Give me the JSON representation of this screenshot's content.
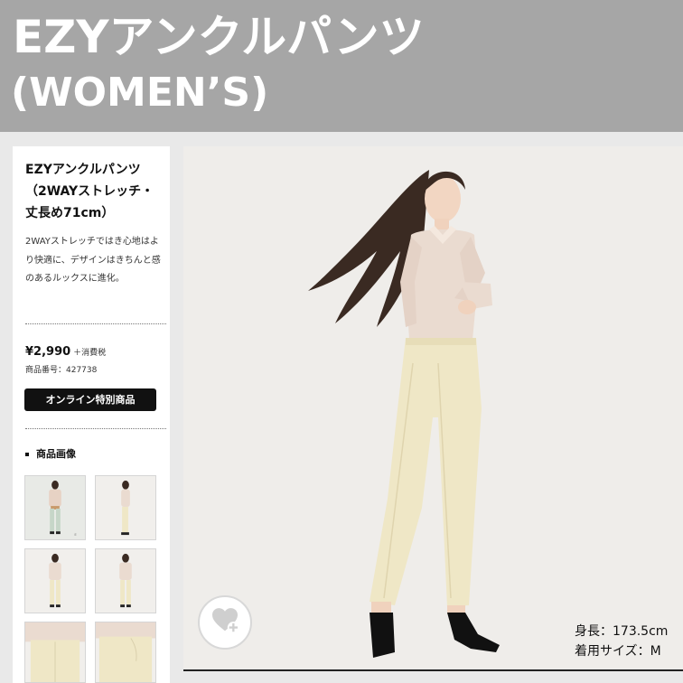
{
  "banner": {
    "title_line1": "EZYアンクルパンツ",
    "title_line2": "(WOMEN’S)"
  },
  "product": {
    "title": "EZYアンクルパンツ（2WAYストレッチ・丈長め71cm）",
    "description": "2WAYストレッチではき心地はより快適に、デザインはきちんと感のあるルックスに進化。",
    "price": "¥2,990",
    "tax_note": "＋消費税",
    "product_number": "商品番号：427738",
    "online_badge": "オンライン特別商品"
  },
  "gallery": {
    "heading": "商品画像",
    "thumbnails": [
      {
        "name": "front-full",
        "icon": "model-front"
      },
      {
        "name": "side-full",
        "icon": "model-side"
      },
      {
        "name": "front-full-2",
        "icon": "model-front"
      },
      {
        "name": "front-full-3",
        "icon": "model-front"
      },
      {
        "name": "detail-waist",
        "icon": "pants-detail"
      },
      {
        "name": "detail-pocket",
        "icon": "pants-detail"
      }
    ]
  },
  "main_image": {
    "model_height": "身長：173.5cm",
    "model_size": "着用サイズ：M",
    "favorite_icon": "heart-plus-icon"
  },
  "colors": {
    "banner_bg": "#a6a6a6",
    "page_bg": "#e9e9e9",
    "photo_bg": "#efedea",
    "pants": "#efe7c6",
    "blouse": "#eadbd0",
    "badge_bg": "#111111"
  }
}
